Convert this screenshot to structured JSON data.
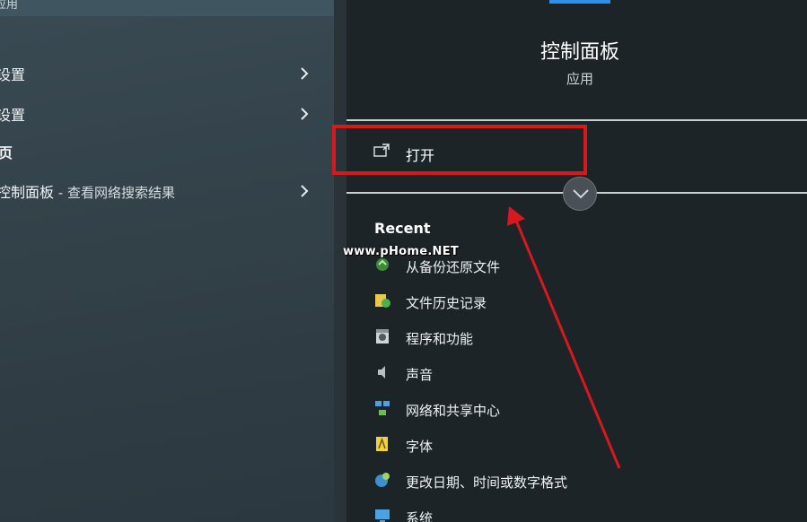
{
  "left": {
    "top_partial": "应用",
    "results": [
      {
        "label": "设置",
        "sub": "",
        "chevron": true
      },
      {
        "label": "设置",
        "sub": "",
        "chevron": true
      },
      {
        "label": "网页",
        "sub": "",
        "chevron": false
      },
      {
        "label": "控制面板",
        "sub": " - 查看网络搜索结果",
        "chevron": true
      }
    ]
  },
  "detail": {
    "title": "控制面板",
    "subtitle": "应用",
    "open_label": "打开",
    "recent_heading": "Recent",
    "watermark": "www.pHome.NET",
    "recent": [
      {
        "label": "从备份还原文件",
        "icon": "backup-restore-icon"
      },
      {
        "label": "文件历史记录",
        "icon": "file-history-icon"
      },
      {
        "label": "程序和功能",
        "icon": "programs-features-icon"
      },
      {
        "label": "声音",
        "icon": "speaker-icon"
      },
      {
        "label": "网络和共享中心",
        "icon": "network-center-icon"
      },
      {
        "label": "字体",
        "icon": "fonts-icon"
      },
      {
        "label": "更改日期、时间或数字格式",
        "icon": "region-format-icon"
      },
      {
        "label": "系统",
        "icon": "system-icon"
      }
    ]
  },
  "colors": {
    "highlight": "#d7181f",
    "accent": "#2f8fe6"
  }
}
